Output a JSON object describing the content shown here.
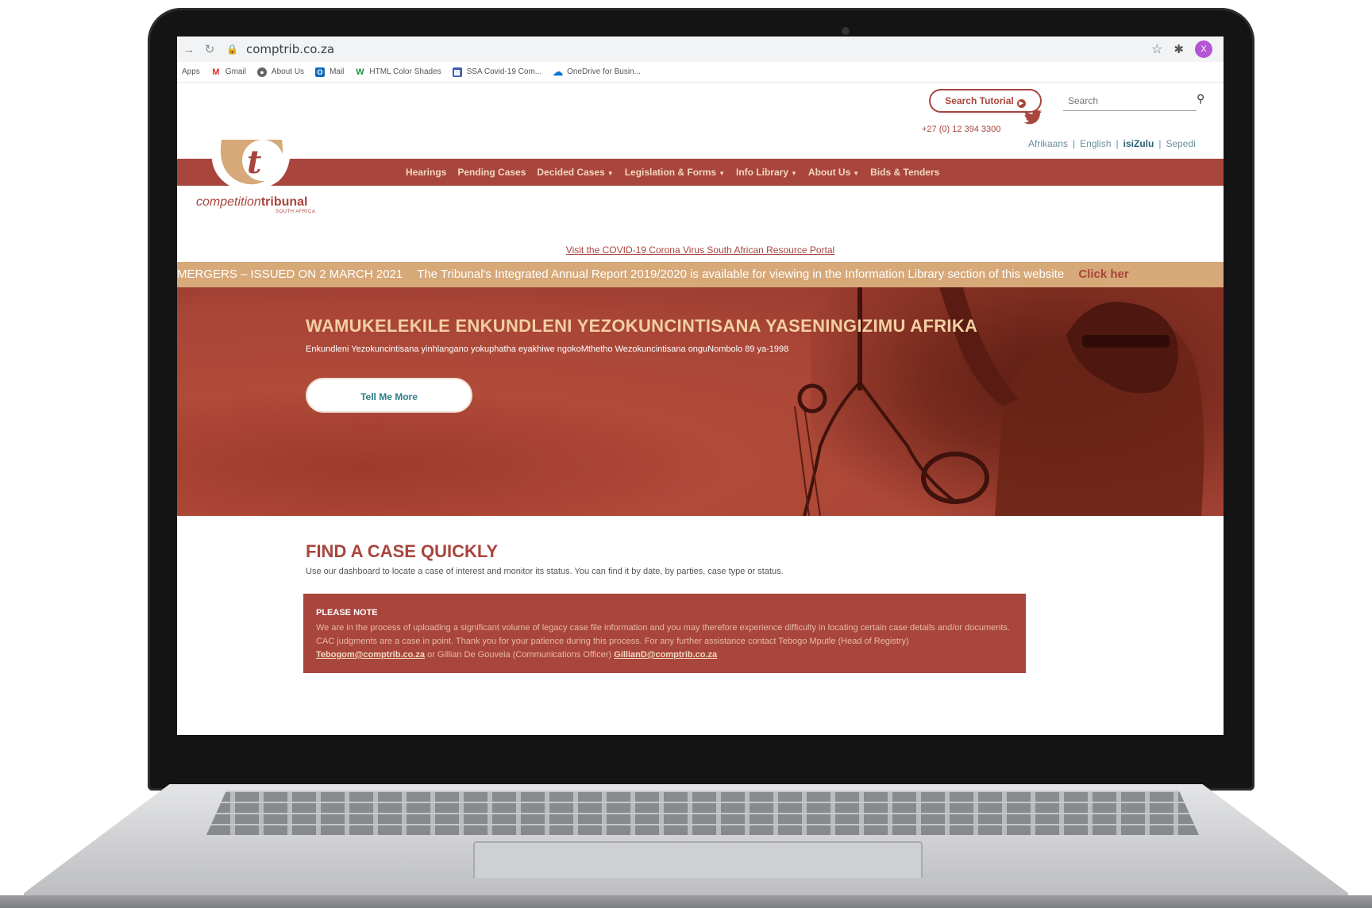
{
  "browser": {
    "url": "comptrib.co.za",
    "profile_initial": "X",
    "bookmarks": [
      {
        "label": "Apps",
        "icon": "apps-icon"
      },
      {
        "label": "Gmail",
        "icon": "gmail-icon"
      },
      {
        "label": "About Us",
        "icon": "globe-icon"
      },
      {
        "label": "Mail",
        "icon": "outlook-icon"
      },
      {
        "label": "HTML Color Shades",
        "icon": "w-icon"
      },
      {
        "label": "SSA Covid-19 Com...",
        "icon": "calendar-icon"
      },
      {
        "label": "OneDrive for Busin...",
        "icon": "onedrive-icon"
      }
    ]
  },
  "header": {
    "search_tutorial": "Search Tutorial",
    "search_placeholder": "Search",
    "phone": "+27 (0) 12 394 3300",
    "languages": [
      "Afrikaans",
      "English",
      "isiZulu",
      "Sepedi"
    ],
    "active_language": "isiZulu"
  },
  "logo": {
    "text_light": "competition",
    "text_bold": "tribunal",
    "sub": "SOUTH AFRICA"
  },
  "nav": {
    "items": [
      {
        "label": "Hearings",
        "dropdown": false
      },
      {
        "label": "Pending Cases",
        "dropdown": false
      },
      {
        "label": "Decided Cases",
        "dropdown": true
      },
      {
        "label": "Legislation & Forms",
        "dropdown": true
      },
      {
        "label": "Info Library",
        "dropdown": true
      },
      {
        "label": "About Us",
        "dropdown": true
      },
      {
        "label": "Bids & Tenders",
        "dropdown": false
      }
    ]
  },
  "covid_link": "Visit the COVID-19 Corona Virus South African Resource Portal",
  "ticker": {
    "item1": "MERGERS – ISSUED ON 2 MARCH 2021",
    "item2": "The Tribunal's Integrated Annual Report 2019/2020 is available for viewing in the Information Library section of this website",
    "link": "Click her"
  },
  "hero": {
    "title": "WAMUKELEKILE ENKUNDLENI YEZOKUNCINTISANA YASENINGIZIMU AFRIKA",
    "subtitle": "Enkundleni Yezokuncintisana yinhlangano yokuphatha eyakhiwe ngokoMthetho Wezokuncintisana onguNombolo 89 ya-1998",
    "button": "Tell Me More"
  },
  "find_case": {
    "title": "FIND A CASE QUICKLY",
    "description": "Use our dashboard to locate a case of interest and monitor its status. You can find it by date, by parties, case type or status."
  },
  "note": {
    "title": "PLEASE NOTE",
    "text1": "We are in the process of uploading a significant volume of legacy case file information and you may therefore experience difficulty in locating certain case details and/or documents. CAC judgments are a case in point. Thank you for your patience during this process. For any further assistance contact Tebogo Mputle (Head of Registry)",
    "email1": "Tebogom@comptrib.co.za",
    "text2": "or Gillian De Gouveia (Communications Officer)",
    "email2": "GillianD@comptrib.co.za"
  },
  "colors": {
    "brand_red": "#a8453d",
    "brand_gold": "#d7a878",
    "accent_teal": "#2a7f86"
  }
}
